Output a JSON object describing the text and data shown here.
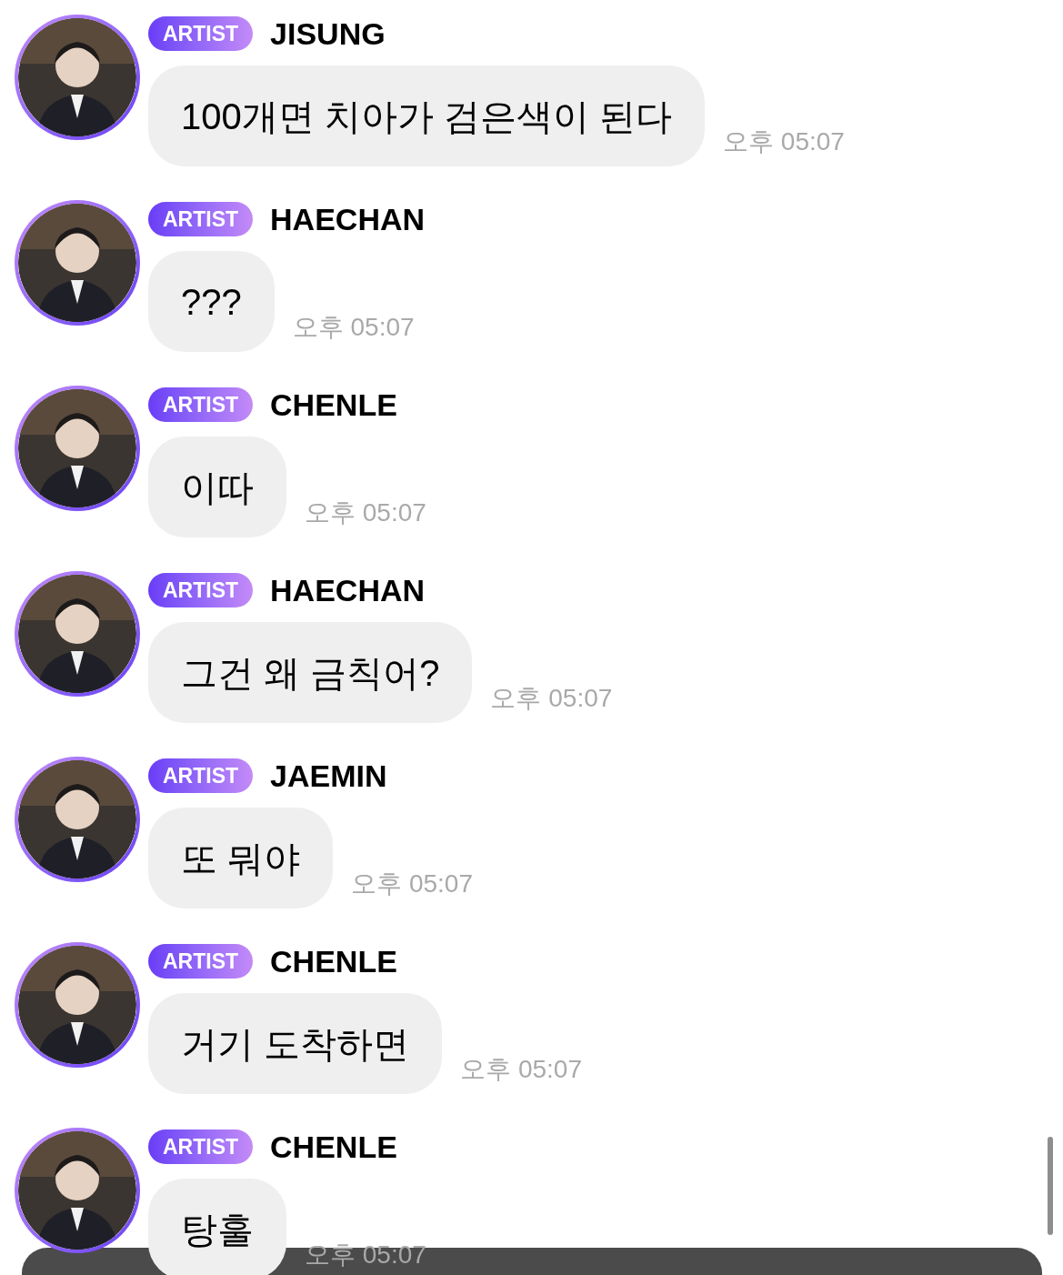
{
  "messages": [
    {
      "badge": "ARTIST",
      "name": "JISUNG",
      "text": "100개면 치아가 검은색이 된다",
      "time": "오후 05:07"
    },
    {
      "badge": "ARTIST",
      "name": "HAECHAN",
      "text": "???",
      "time": "오후 05:07"
    },
    {
      "badge": "ARTIST",
      "name": "CHENLE",
      "text": "이따",
      "time": "오후 05:07"
    },
    {
      "badge": "ARTIST",
      "name": "HAECHAN",
      "text": "그건 왜 금칙어?",
      "time": "오후 05:07"
    },
    {
      "badge": "ARTIST",
      "name": "JAEMIN",
      "text": "또 뭐야",
      "time": "오후 05:07"
    },
    {
      "badge": "ARTIST",
      "name": "CHENLE",
      "text": "거기 도착하면",
      "time": "오후 05:07"
    },
    {
      "badge": "ARTIST",
      "name": "CHENLE",
      "text": "탕훌",
      "time": "오후 05:07"
    }
  ]
}
